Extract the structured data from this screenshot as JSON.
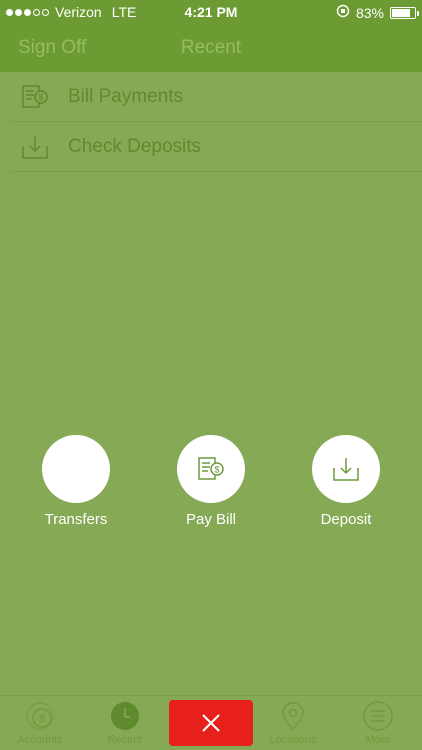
{
  "status_bar": {
    "carrier": "Verizon",
    "network": "LTE",
    "time": "4:21 PM",
    "battery": "83%",
    "battery_level": 0.83
  },
  "nav": {
    "left_label": "Sign Off",
    "title": "Recent"
  },
  "list": [
    {
      "label": "Bill Payments",
      "icon": "bill-icon"
    },
    {
      "label": "Check Deposits",
      "icon": "deposit-icon"
    }
  ],
  "actions": [
    {
      "label": "Transfers",
      "icon": "transfer-icon"
    },
    {
      "label": "Pay Bill",
      "icon": "bill-icon"
    },
    {
      "label": "Deposit",
      "icon": "deposit-icon"
    }
  ],
  "tabs": [
    {
      "label": "Accounts",
      "icon": "dollar-icon"
    },
    {
      "label": "Recent",
      "icon": "clock-icon"
    },
    {
      "label": "",
      "icon": "close-icon"
    },
    {
      "label": "Locations",
      "icon": "location-pin-icon"
    },
    {
      "label": "More",
      "icon": "menu-icon"
    }
  ],
  "colors": {
    "background": "#86a955",
    "header": "#6c9a33",
    "close_button": "#e8201c",
    "accent_text": "#5f8a2d"
  }
}
